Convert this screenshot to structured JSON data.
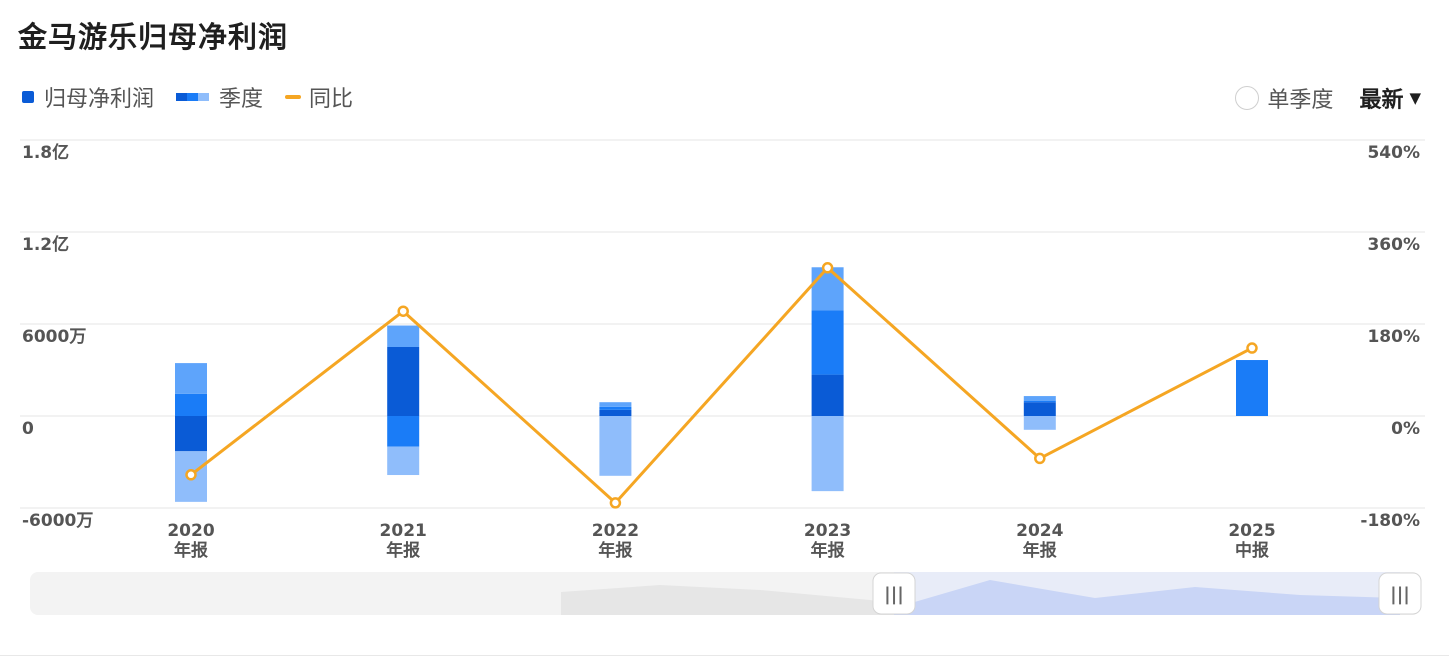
{
  "title": "金马游乐归母净利润",
  "legend": {
    "net_profit": "归母净利润",
    "quarter": "季度",
    "yoy": "同比"
  },
  "controls": {
    "single_quarter_label": "单季度",
    "latest_label": "最新",
    "caret": "▼"
  },
  "colors": {
    "q1": "#0a5bd6",
    "q2": "#1a7cf7",
    "q3": "#5ea4fb",
    "q4": "#8fbdfb",
    "line": "#f5a623",
    "grid": "#e6e6e6",
    "slider_fill": "#c9d5f6",
    "slider_bg": "#f3f3f3",
    "slider_shadow": "#e6e6e6"
  },
  "chart_data": {
    "type": "bar",
    "stacked": true,
    "categories": [
      [
        "2020",
        "年报"
      ],
      [
        "2021",
        "年报"
      ],
      [
        "2022",
        "年报"
      ],
      [
        "2023",
        "年报"
      ],
      [
        "2024",
        "年报"
      ],
      [
        "2025",
        "中报"
      ]
    ],
    "y_left": {
      "ticks": [
        -6000,
        0,
        6000,
        12000,
        18000
      ],
      "tick_labels": [
        "-6000万",
        "0",
        "6000万",
        "1.2亿",
        "1.8亿"
      ],
      "range": [
        -6000,
        18000
      ]
    },
    "y_right": {
      "ticks": [
        -180,
        0,
        180,
        360,
        540
      ],
      "tick_labels": [
        "-180%",
        "0%",
        "180%",
        "360%",
        "540%"
      ],
      "range": [
        -180,
        540
      ]
    },
    "series": [
      {
        "name": "Q1",
        "values": [
          -2300,
          4500,
          400,
          2700,
          900,
          0
        ]
      },
      {
        "name": "Q2",
        "values": [
          1450,
          -2000,
          200,
          4200,
          100,
          3650
        ]
      },
      {
        "name": "Q3",
        "values": [
          2000,
          1400,
          300,
          2800,
          300,
          0
        ]
      },
      {
        "name": "Q4",
        "values": [
          -3300,
          -1850,
          -3900,
          -4900,
          -900,
          0
        ]
      }
    ],
    "yoy_percent": [
      -115,
      205,
      -170,
      290,
      -83,
      133
    ],
    "units": {
      "left": "万",
      "right": "%"
    }
  },
  "slider": {
    "handle_glyph": "|||"
  }
}
